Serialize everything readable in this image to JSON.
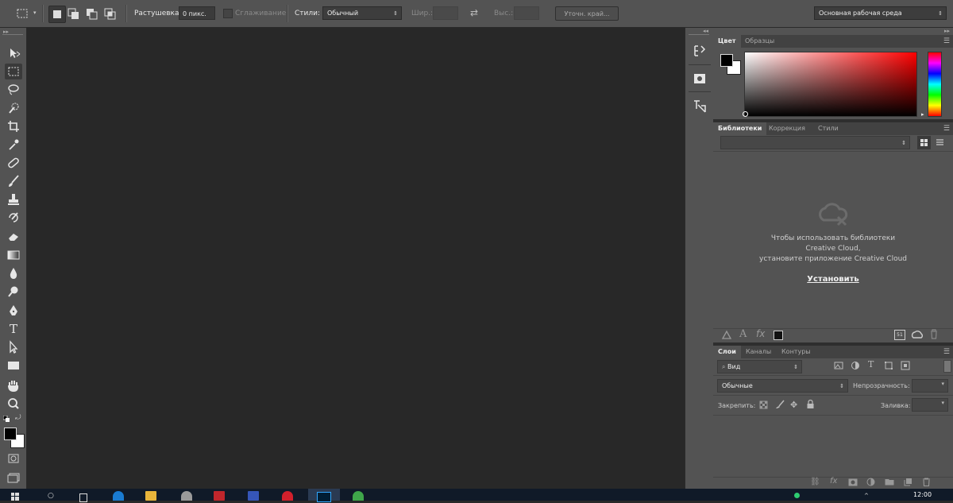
{
  "options_bar": {
    "feather_label": "Растушевка:",
    "feather_value": "0 пикс.",
    "antialias_label": "Сглаживание",
    "style_label": "Стили:",
    "style_value": "Обычный",
    "width_label": "Шир.:",
    "height_label": "Выс.:",
    "refine_edge_label": "Уточн. край...",
    "workspace_value": "Основная рабочая среда"
  },
  "color_panel": {
    "tabs": [
      "Цвет",
      "Образцы"
    ],
    "foreground": "#000000",
    "background": "#ffffff",
    "hue_color": "#ff0000"
  },
  "libraries_panel": {
    "tabs": [
      "Библиотеки",
      "Коррекция",
      "Стили"
    ],
    "message_line1": "Чтобы использовать библиотеки",
    "message_line2": "Creative Cloud,",
    "message_line3": "установите приложение Creative Cloud",
    "install_link": "Установить",
    "status_count": "51"
  },
  "layers_panel": {
    "tabs": [
      "Слои",
      "Каналы",
      "Контуры"
    ],
    "filter_value": "Вид",
    "blend_mode": "Обычные",
    "opacity_label": "Непрозрачность:",
    "lock_label": "Закрепить:",
    "fill_label": "Заливка:"
  },
  "taskbar": {
    "clock": "12:00"
  },
  "colors": {
    "ui_bg": "#535353",
    "canvas_bg": "#282828",
    "accent_blue": "#1473e6"
  }
}
